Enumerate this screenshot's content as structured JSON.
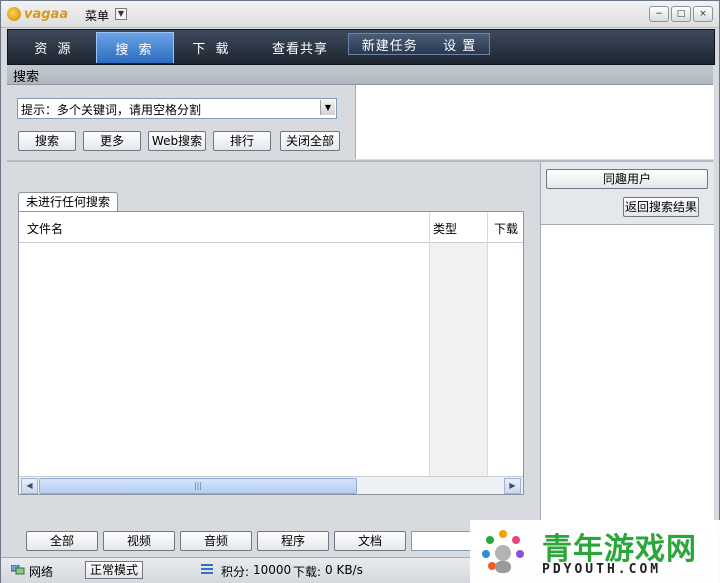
{
  "app": {
    "logo_text": "vagaa",
    "menu_label": "菜单"
  },
  "window_buttons": {
    "minimize": "−",
    "maximize": "□",
    "close": "×"
  },
  "nav": {
    "tabs": [
      {
        "label": "资 源"
      },
      {
        "label": "搜 索"
      },
      {
        "label": "下 载"
      },
      {
        "label": "查看共享"
      }
    ],
    "extra": [
      {
        "label": "新建任务"
      },
      {
        "label": "设 置"
      }
    ],
    "active_index": 1
  },
  "section_title": "搜索",
  "search": {
    "hint": "提示：多个关键词，请用空格分割",
    "buttons": [
      "搜索",
      "更多",
      "Web搜索",
      "排行",
      "关闭全部"
    ]
  },
  "results": {
    "tab_label": "未进行任何搜索",
    "columns": [
      "文件名",
      "类型",
      "下载"
    ]
  },
  "sidebar": {
    "same_interest_button": "同趣用户",
    "back_button": "返回搜索结果"
  },
  "filters": [
    "全部",
    "视频",
    "音频",
    "程序",
    "文档"
  ],
  "status": {
    "network": "网络",
    "mode": "正常模式",
    "points_label": "积分:",
    "points_value": "10000",
    "download_label": "下载:",
    "download_speed": "0 KB/s"
  },
  "watermark": {
    "title": "青年游戏网",
    "subtitle": "PDYOUTH.COM"
  },
  "colors": {
    "nav_bg": "#1e2530",
    "nav_active": "#2d6cc0",
    "watermark_green": "#2aa63a"
  }
}
